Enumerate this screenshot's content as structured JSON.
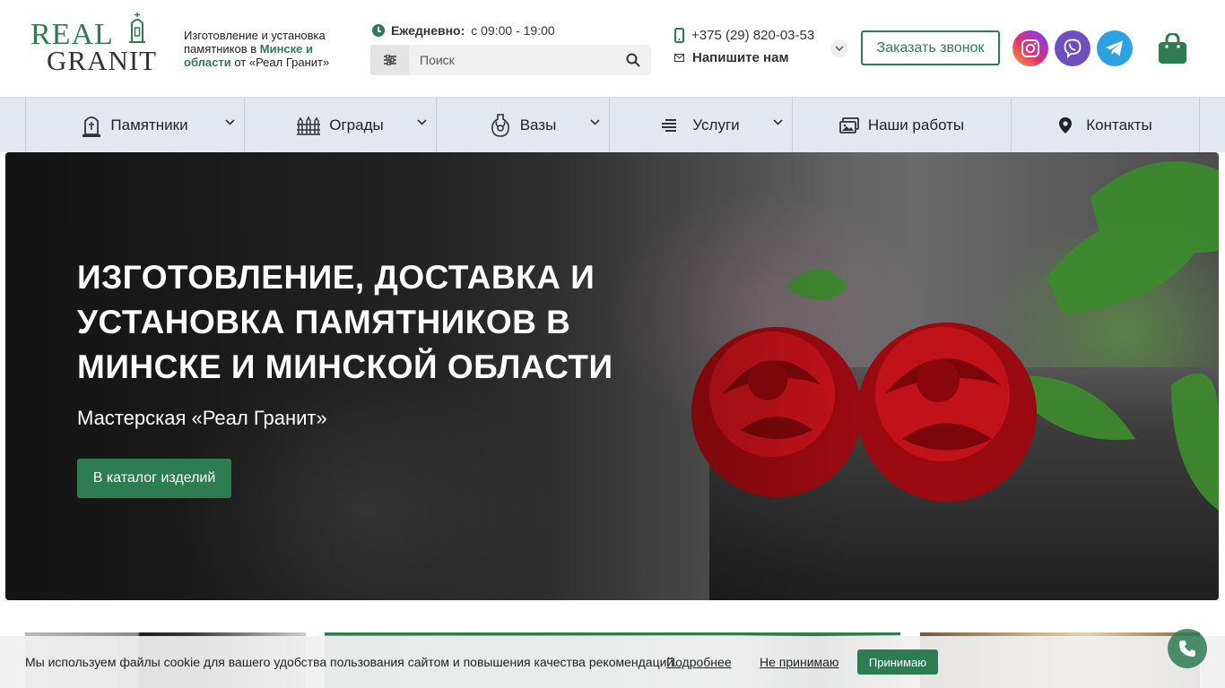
{
  "header": {
    "logo": {
      "word1": "REAL",
      "word2": "GRANIT"
    },
    "tagline": {
      "part1": "Изготовление и установка памятников в ",
      "highlight": "Минске и области",
      "part2": " от «Реал Гранит»"
    },
    "hours": {
      "label": "Ежедневно:",
      "value": "с 09:00 - 19:00"
    },
    "search": {
      "placeholder": "Поиск"
    },
    "phone": "+375 (29) 820-03-53",
    "write_us": "Напишите нам",
    "callback_button": "Заказать звонок",
    "social": [
      "instagram-icon",
      "viber-icon",
      "telegram-icon"
    ]
  },
  "nav": {
    "items": [
      {
        "label": "Памятники",
        "icon": "monument-icon",
        "dropdown": true
      },
      {
        "label": "Ограды",
        "icon": "fence-icon",
        "dropdown": true
      },
      {
        "label": "Вазы",
        "icon": "vase-icon",
        "dropdown": true
      },
      {
        "label": "Услуги",
        "icon": "list-icon",
        "dropdown": true
      },
      {
        "label": "Наши работы",
        "icon": "gallery-icon",
        "dropdown": false
      },
      {
        "label": "Контакты",
        "icon": "location-pin-icon",
        "dropdown": false
      }
    ]
  },
  "hero": {
    "title": "ИЗГОТОВЛЕНИЕ, ДОСТАВКА И УСТАНОВКА ПАМЯТНИКОВ В МИНСКЕ И МИНСКОЙ ОБЛАСТИ",
    "subtitle": "Мастерская «Реал Гранит»",
    "button": "В каталог изделий"
  },
  "cookie": {
    "message": "Мы используем файлы cookie для вашего удобства пользования сайтом и повышения качества рекомендаций.",
    "more": "Подробнее",
    "decline": "Не принимаю",
    "accept": "Принимаю"
  },
  "colors": {
    "accent": "#2e7d52",
    "nav_bg": "#e3e8f0"
  }
}
